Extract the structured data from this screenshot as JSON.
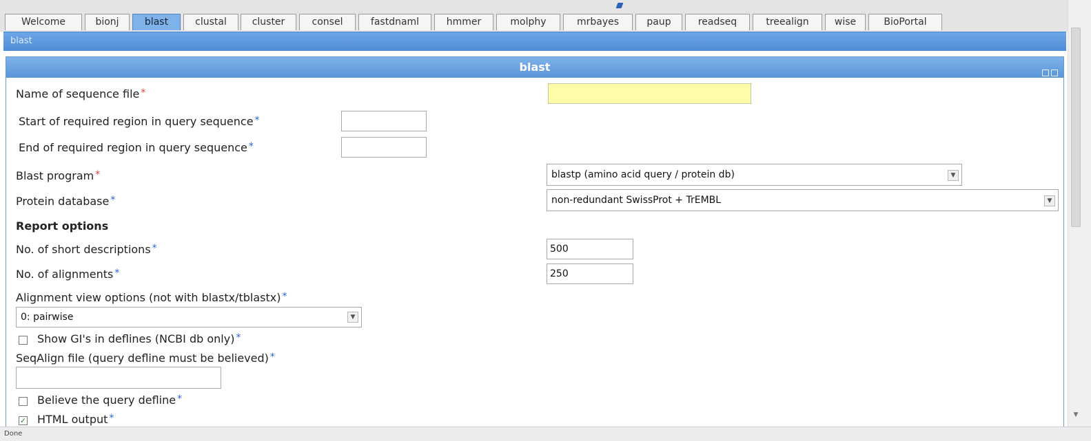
{
  "tabs": [
    "Welcome",
    "bionj",
    "blast",
    "clustal",
    "cluster",
    "consel",
    "fastdnaml",
    "hmmer",
    "molphy",
    "mrbayes",
    "paup",
    "readseq",
    "treealign",
    "wise",
    "BioPortal"
  ],
  "breadcrumb": "blast",
  "panel": {
    "title": "blast"
  },
  "form": {
    "seq_file_label": "Name of sequence file",
    "seq_file_value": "",
    "start_label": "Start of required region in query sequence",
    "start_value": "",
    "end_label": "End of required region in query sequence",
    "end_value": "",
    "program_label": "Blast program",
    "program_value": "blastp (amino acid query / protein db)",
    "database_label": "Protein database",
    "database_value": "non-redundant SwissProt + TrEMBL",
    "report_heading": "Report options",
    "short_desc_label": "No. of short descriptions",
    "short_desc_value": "500",
    "alignments_label": "No. of alignments",
    "alignments_value": "250",
    "align_view_label": "Alignment view options (not with blastx/tblastx)",
    "align_view_value": "0: pairwise",
    "show_gi_label": "Show GI's in deflines (NCBI db only)",
    "show_gi_checked": false,
    "seqalign_label": "SeqAlign file (query defline must be believed)",
    "seqalign_value": "",
    "believe_label": "Believe the query defline",
    "believe_checked": false,
    "html_label": "HTML output",
    "html_checked": true
  },
  "required_mark": "*",
  "status": "Done",
  "colors": {
    "accent": "#5a95d8",
    "tab_active": "#7fb2e8",
    "required_red": "#e53a3a",
    "required_blue": "#2b5fd9",
    "highlight_input": "#fffca8"
  }
}
